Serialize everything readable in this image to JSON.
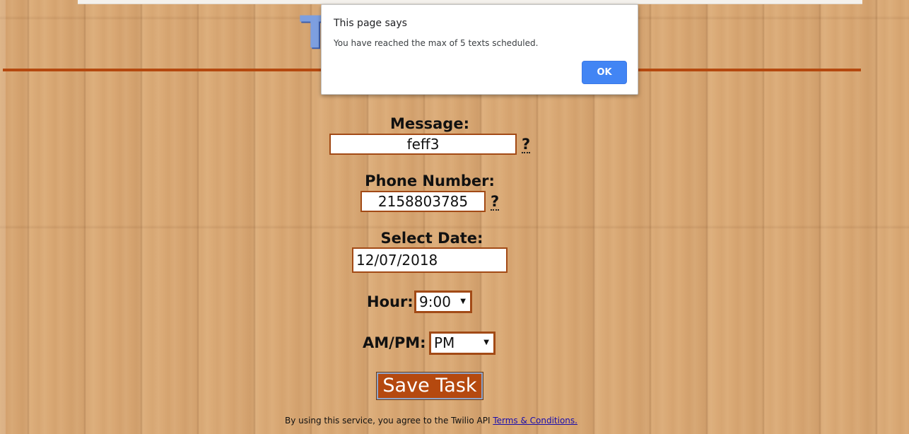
{
  "logo": {
    "text": "T"
  },
  "form": {
    "message": {
      "label": "Message:",
      "value": "feff3",
      "help": "?"
    },
    "phone": {
      "label": "Phone Number:",
      "value": "2158803785",
      "help": "?"
    },
    "date": {
      "label": "Select Date:",
      "value": "12/07/2018"
    },
    "hour": {
      "label": "Hour:",
      "value": "9:00",
      "arrow": "▼"
    },
    "ampm": {
      "label": "AM/PM:",
      "value": "PM",
      "arrow": "▼"
    },
    "save_label": "Save Task"
  },
  "footer": {
    "text": "By using this service, you agree to the Twilio API ",
    "link": "Terms & Conditions."
  },
  "dialog": {
    "title": "This page says",
    "message": "You have reached the max of 5 texts scheduled.",
    "ok_label": "OK"
  },
  "colors": {
    "accent": "#b5490f",
    "dialog_button": "#4285f4",
    "background": "#d9a874"
  }
}
